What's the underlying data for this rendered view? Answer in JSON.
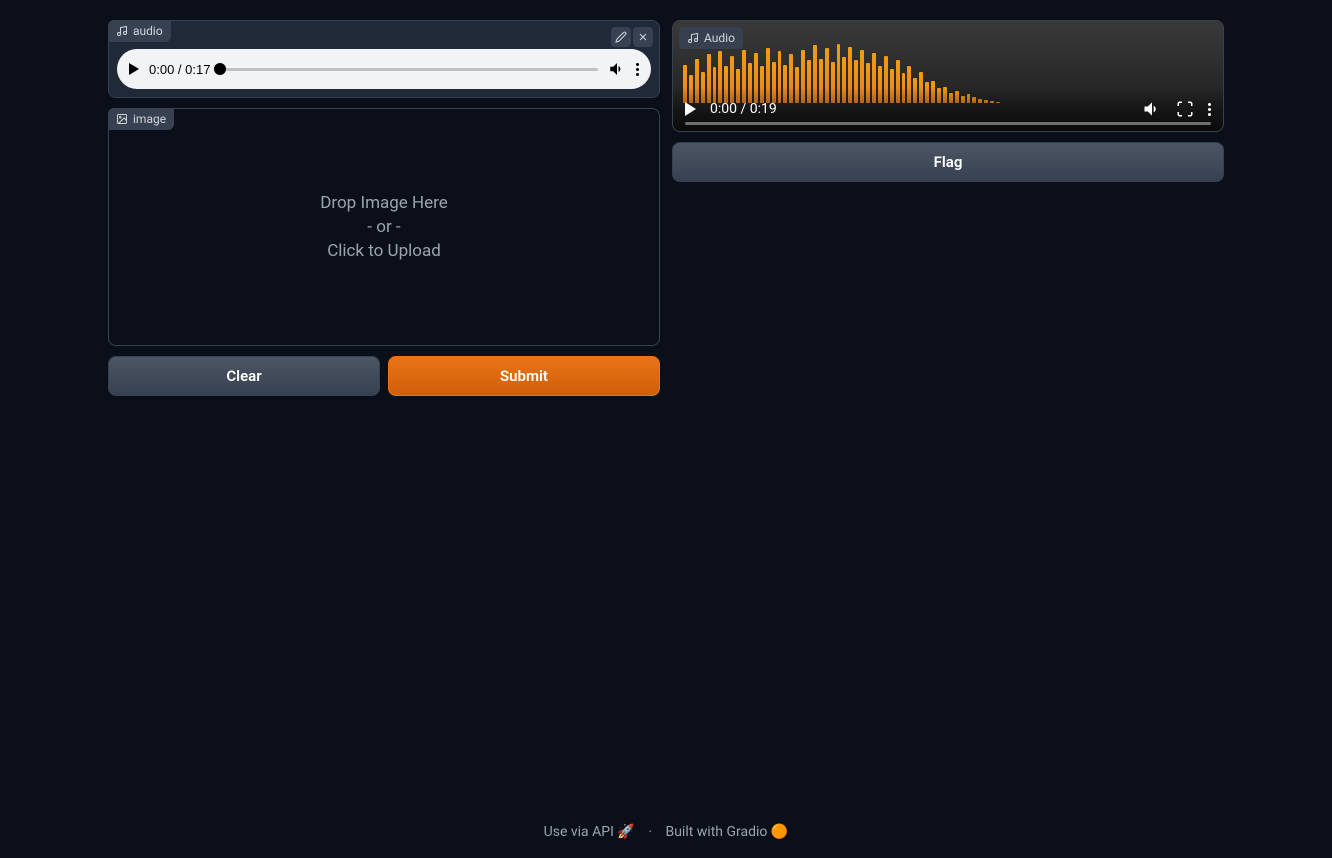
{
  "input": {
    "audio": {
      "label": "audio",
      "current_time": "0:00",
      "duration": "0:17"
    },
    "image": {
      "label": "image",
      "drop_text": "Drop Image Here",
      "or_text": "- or -",
      "click_text": "Click to Upload"
    },
    "buttons": {
      "clear": "Clear",
      "submit": "Submit"
    }
  },
  "output": {
    "audio": {
      "label": "Audio",
      "current_time": "0:00",
      "duration": "0:19"
    },
    "flag": "Flag"
  },
  "footer": {
    "api_text": "Use via API",
    "api_emoji": "🚀",
    "separator": "·",
    "built_text": "Built with Gradio",
    "gradio_emoji": "🟠"
  },
  "waveform_heights": [
    52,
    38,
    60,
    42,
    66,
    48,
    70,
    50,
    64,
    46,
    72,
    54,
    68,
    50,
    74,
    56,
    70,
    52,
    66,
    48,
    72,
    58,
    78,
    60,
    74,
    56,
    80,
    62,
    76,
    58,
    72,
    54,
    68,
    50,
    64,
    46,
    58,
    40,
    50,
    34,
    42,
    28,
    30,
    20,
    22,
    14,
    16,
    10,
    12,
    8,
    6,
    4,
    3,
    2,
    0,
    0,
    0,
    0,
    0,
    0,
    0,
    0,
    0,
    0,
    0,
    0,
    0,
    0,
    0,
    0,
    0,
    0,
    0,
    0,
    0,
    0,
    0,
    0,
    0,
    0,
    0,
    0,
    0,
    0,
    0,
    0,
    0,
    0,
    0,
    0
  ]
}
